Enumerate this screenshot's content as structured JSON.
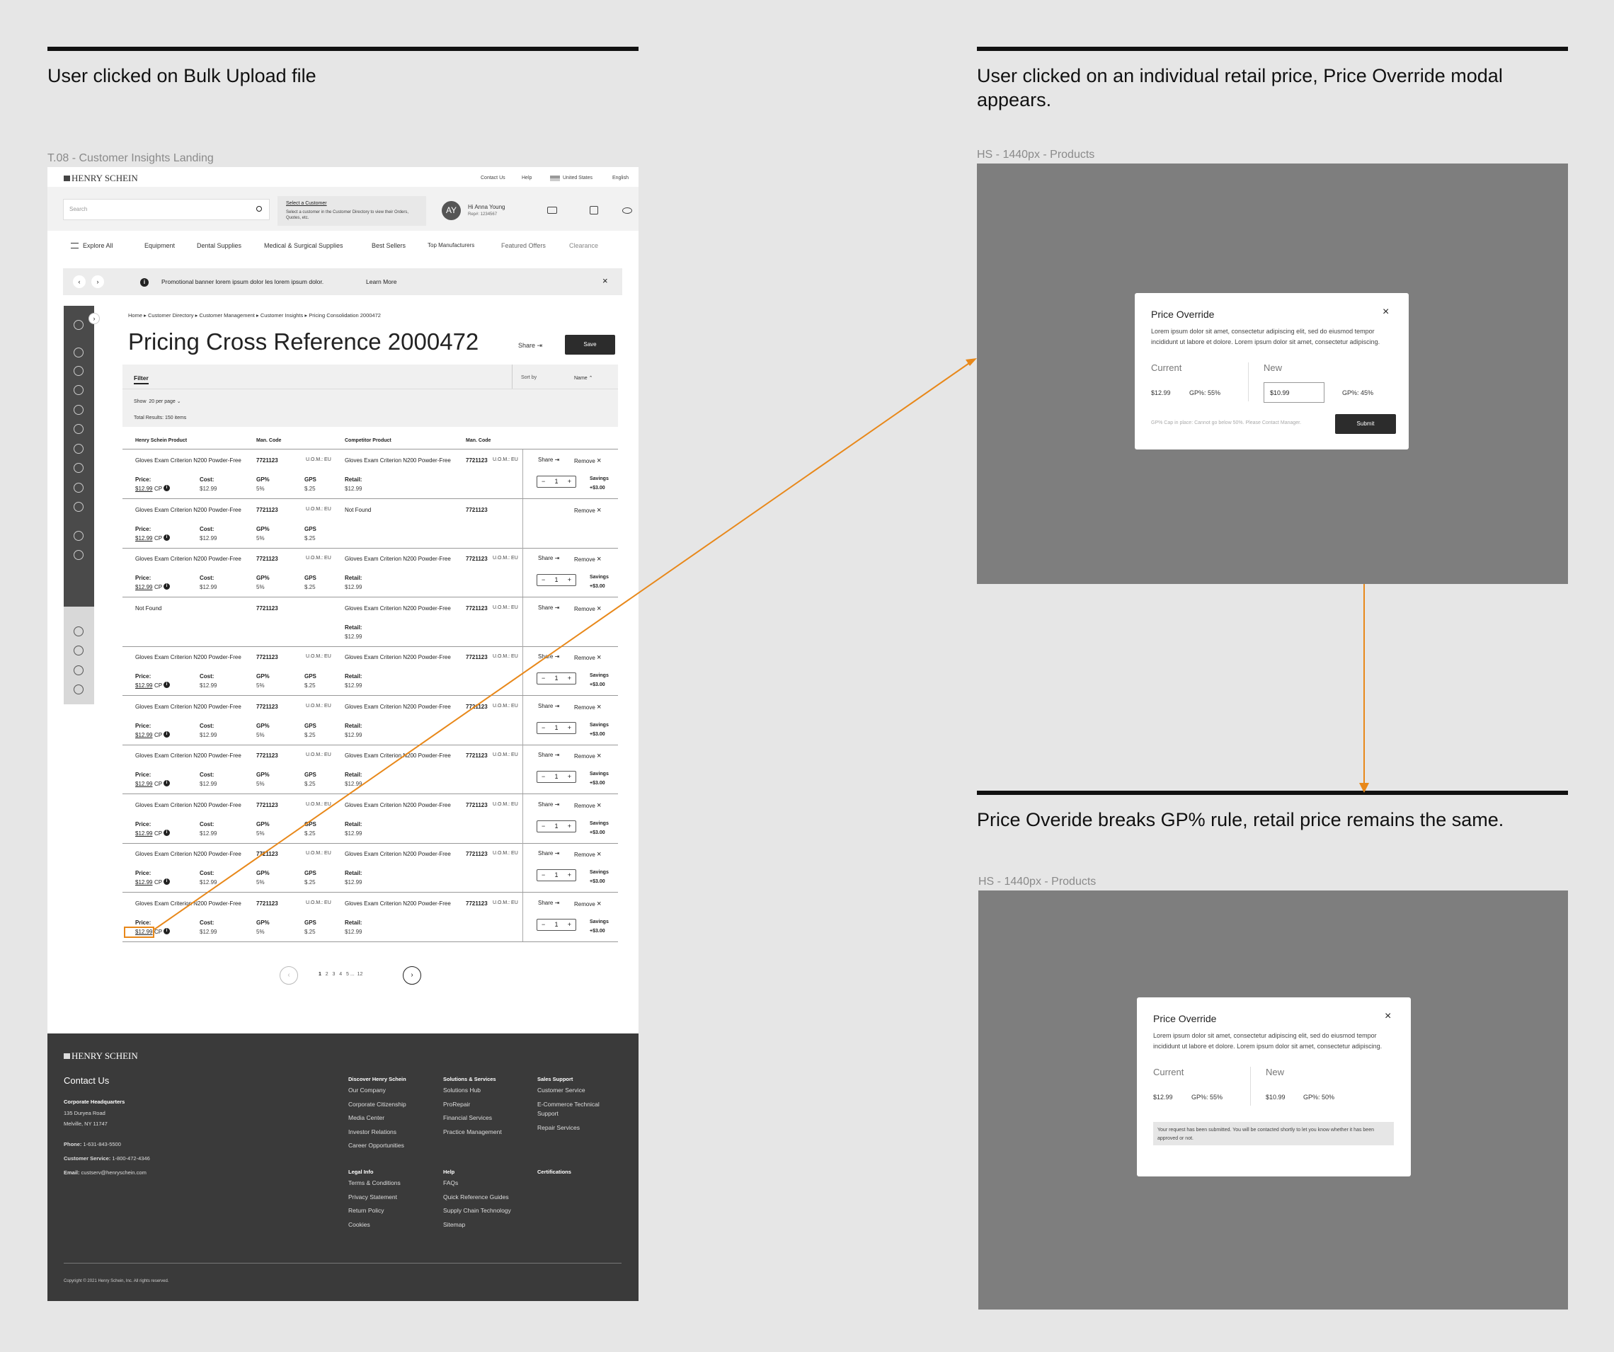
{
  "annotations": {
    "left_heading": "User clicked on Bulk Upload file",
    "right_heading_1": "User clicked on an individual retail price, Price Override modal appears.",
    "right_heading_2": "Price Overide breaks GP% rule, retail price remains the same.",
    "frame_label_left": "T.08 - Customer Insights Landing",
    "frame_label_right_1": "HS - 1440px - Products",
    "frame_label_right_2": "HS - 1440px - Products"
  },
  "colors": {
    "accent_orange": "#e8881a",
    "dark": "#2c2c2c",
    "footer": "#3a3a3a",
    "overlay": "#7e7e7e"
  },
  "page": {
    "logo": "HENRY SCHEIN",
    "top_links": [
      "Contact Us",
      "Help",
      "United States",
      "English"
    ],
    "search_placeholder": "Search",
    "select_customer_title": "Select a Customer",
    "select_customer_desc": "Select a customer in the Customer Directory to view their Orders, Quotes, etc.",
    "avatar": "AY",
    "user_greeting": "Hi Anna Young",
    "user_rep": "Rep#: 1234567",
    "nav": [
      "Explore All",
      "Equipment",
      "Dental Supplies",
      "Medical & Surgical Supplies",
      "Best Sellers",
      "Top Manufacturers",
      "Featured Offers",
      "Clearance"
    ],
    "banner_text": "Promotional banner lorem ipsum dolor les lorem ipsum dolor.",
    "banner_link": "Learn More",
    "breadcrumb": [
      "Home",
      "Customer Directory",
      "Customer Management",
      "Customer Insights",
      "Pricing Consolidation 2000472"
    ],
    "title": "Pricing Cross Reference 2000472",
    "share": "Share",
    "save": "Save",
    "filter": "Filter",
    "sort_by": "Sort by",
    "sort_value": "Name",
    "show": "Show",
    "per_page": "20 per page",
    "total": "Total Results: 150 items",
    "headers": [
      "Henry Schein Product",
      "Man. Code",
      "Competitor Product",
      "Man. Code"
    ],
    "labels": {
      "price": "Price:",
      "cost": "Cost:",
      "gp": "GP%",
      "gps": "GPS",
      "retail": "Retail:",
      "savings": "Savings",
      "share": "Share",
      "remove": "Remove",
      "cp": "CP",
      "uom": "U.O.M.: EU"
    },
    "rows": [
      {
        "hs": "Gloves Exam Criterion N200 Powder-Free",
        "code": "7721123",
        "comp": "Gloves Exam Criterion N200 Powder-Free",
        "comp_code": "7721123",
        "price": "$12.99",
        "cost": "$12.99",
        "gp": "5%",
        "gps": "$.25",
        "retail": "$12.99",
        "savings": "+$3.00",
        "qty": "1"
      },
      {
        "hs": "Gloves Exam Criterion N200 Powder-Free",
        "code": "7721123",
        "comp": "Not Found",
        "comp_code": "7721123",
        "price": "$12.99",
        "cost": "$12.99",
        "gp": "5%",
        "gps": "$.25"
      },
      {
        "hs": "Gloves Exam Criterion N200 Powder-Free",
        "code": "7721123",
        "comp": "Gloves Exam Criterion N200 Powder-Free",
        "comp_code": "7721123",
        "price": "$12.99",
        "cost": "$12.99",
        "gp": "5%",
        "gps": "$.25",
        "retail": "$12.99",
        "savings": "+$3.00",
        "qty": "1"
      },
      {
        "hs": "Not Found",
        "code": "7721123",
        "comp": "Gloves Exam Criterion N200 Powder-Free",
        "comp_code": "7721123",
        "retail": "$12.99"
      },
      {
        "hs": "Gloves Exam Criterion N200 Powder-Free",
        "code": "7721123",
        "comp": "Gloves Exam Criterion N200 Powder-Free",
        "comp_code": "7721123",
        "price": "$12.99",
        "cost": "$12.99",
        "gp": "5%",
        "gps": "$.25",
        "retail": "$12.99",
        "savings": "+$3.00",
        "qty": "1"
      },
      {
        "hs": "Gloves Exam Criterion N200 Powder-Free",
        "code": "7721123",
        "comp": "Gloves Exam Criterion N200 Powder-Free",
        "comp_code": "7721123",
        "price": "$12.99",
        "cost": "$12.99",
        "gp": "5%",
        "gps": "$.25",
        "retail": "$12.99",
        "savings": "+$3.00",
        "qty": "1"
      },
      {
        "hs": "Gloves Exam Criterion N200 Powder-Free",
        "code": "7721123",
        "comp": "Gloves Exam Criterion N200 Powder-Free",
        "comp_code": "7721123",
        "price": "$12.99",
        "cost": "$12.99",
        "gp": "5%",
        "gps": "$.25",
        "retail": "$12.99",
        "savings": "+$3.00",
        "qty": "1"
      },
      {
        "hs": "Gloves Exam Criterion N200 Powder-Free",
        "code": "7721123",
        "comp": "Gloves Exam Criterion N200 Powder-Free",
        "comp_code": "7721123",
        "price": "$12.99",
        "cost": "$12.99",
        "gp": "5%",
        "gps": "$.25",
        "retail": "$12.99",
        "savings": "+$3.00",
        "qty": "1"
      },
      {
        "hs": "Gloves Exam Criterion N200 Powder-Free",
        "code": "7721123",
        "comp": "Gloves Exam Criterion N200 Powder-Free",
        "comp_code": "7721123",
        "price": "$12.99",
        "cost": "$12.99",
        "gp": "5%",
        "gps": "$.25",
        "retail": "$12.99",
        "savings": "+$3.00",
        "qty": "1"
      },
      {
        "hs": "Gloves Exam Criterion N200 Powder-Free",
        "code": "7721123",
        "comp": "Gloves Exam Criterion N200 Powder-Free",
        "comp_code": "7721123",
        "price": "$12.99",
        "cost": "$12.99",
        "gp": "5%",
        "gps": "$.25",
        "retail": "$12.99",
        "savings": "+$3.00",
        "qty": "1"
      }
    ],
    "pagination": [
      "1",
      "2",
      "3",
      "4",
      "5",
      "...",
      "12"
    ],
    "footer": {
      "logo": "HENRY SCHEIN",
      "contact_title": "Contact Us",
      "hq_label": "Corporate Headquarters",
      "address1": "135 Duryea Road",
      "address2": "Melville, NY 11747",
      "phone_label": "Phone:",
      "phone": "1-631-843-5500",
      "cs_label": "Customer Service:",
      "cs_phone": "1-800-472-4346",
      "email_label": "Email:",
      "email": "custserv@henryschein.com",
      "col1_title": "Discover Henry Schein",
      "col1": [
        "Our Company",
        "Corporate Citizenship",
        "Media Center",
        "Investor Relations",
        "Career Opportunities"
      ],
      "col2_title": "Solutions & Services",
      "col2": [
        "Solutions Hub",
        "ProRepair",
        "Financial Services",
        "Practice Management"
      ],
      "col3_title": "Sales Support",
      "col3": [
        "Customer Service",
        "E-Commerce Technical Support",
        "Repair Services"
      ],
      "col4_title": "Legal Info",
      "col4": [
        "Terms & Conditions",
        "Privacy Statement",
        "Return Policy",
        "Cookies"
      ],
      "col5_title": "Help",
      "col5": [
        "FAQs",
        "Quick Reference Guides",
        "Supply Chain Technology",
        "Sitemap"
      ],
      "col6_title": "Certifications",
      "copyright": "Copyright © 2021 Henry Schein, Inc. All rights reserved."
    }
  },
  "modal1": {
    "title": "Price Override",
    "desc": "Lorem ipsum dolor sit amet, consectetur adipiscing elit, sed do eiusmod tempor incididunt ut labore et dolore. Lorem ipsum dolor sit amet, consectetur adipiscing.",
    "current_label": "Current",
    "current_price": "$12.99",
    "current_gp": "GP%: 55%",
    "new_label": "New",
    "new_value": "$10.99",
    "new_gp": "GP%: 45%",
    "note": "GP% Cap in place: Cannot go below 50%. Please Contact Manager.",
    "submit": "Submit"
  },
  "modal2": {
    "title": "Price Override",
    "desc": "Lorem ipsum dolor sit amet, consectetur adipiscing elit, sed do eiusmod tempor incididunt ut labore et dolore. Lorem ipsum dolor sit amet, consectetur adipiscing.",
    "current_label": "Current",
    "current_price": "$12.99",
    "current_gp": "GP%: 55%",
    "new_label": "New",
    "new_price": "$10.99",
    "new_gp": "GP%: 50%",
    "message": "Your request has been submitted. You will be contacted shortly to let you know whether it has been approved or not."
  }
}
